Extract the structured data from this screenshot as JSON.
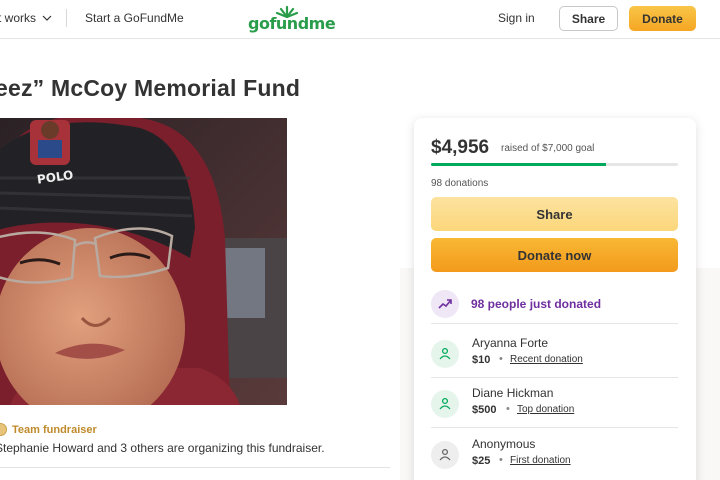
{
  "header": {
    "how_it_works": "t works",
    "start": "Start a GoFundMe",
    "logo_text": "gofundme",
    "signin": "Sign in",
    "share": "Share",
    "donate": "Donate"
  },
  "campaign": {
    "title": "eez” McCoy Memorial Fund",
    "photo_badge": "POLO",
    "team_label": "Team fundraiser",
    "organizer_text": "Stephanie Howard and 3 others are organizing this fundraiser."
  },
  "card": {
    "raised": "$4,956",
    "goal_text": "raised of $7,000 goal",
    "progress_fraction": 0.708,
    "donations_count": "98 donations",
    "share_button": "Share",
    "donate_button": "Donate now",
    "trend_text": "98 people just donated",
    "donors": [
      {
        "name": "Aryanna Forte",
        "amount": "$10",
        "tag": "Recent donation",
        "icon": "donor-heart-icon"
      },
      {
        "name": "Diane Hickman",
        "amount": "$500",
        "tag": "Top donation",
        "icon": "donor-heart-icon"
      },
      {
        "name": "Anonymous",
        "amount": "$25",
        "tag": "First donation",
        "icon": "donor-heart-icon"
      }
    ]
  },
  "colors": {
    "brand_green": "#02a95c",
    "donate_orange": "#f5a623",
    "trend_purple": "#6f2f9e"
  }
}
